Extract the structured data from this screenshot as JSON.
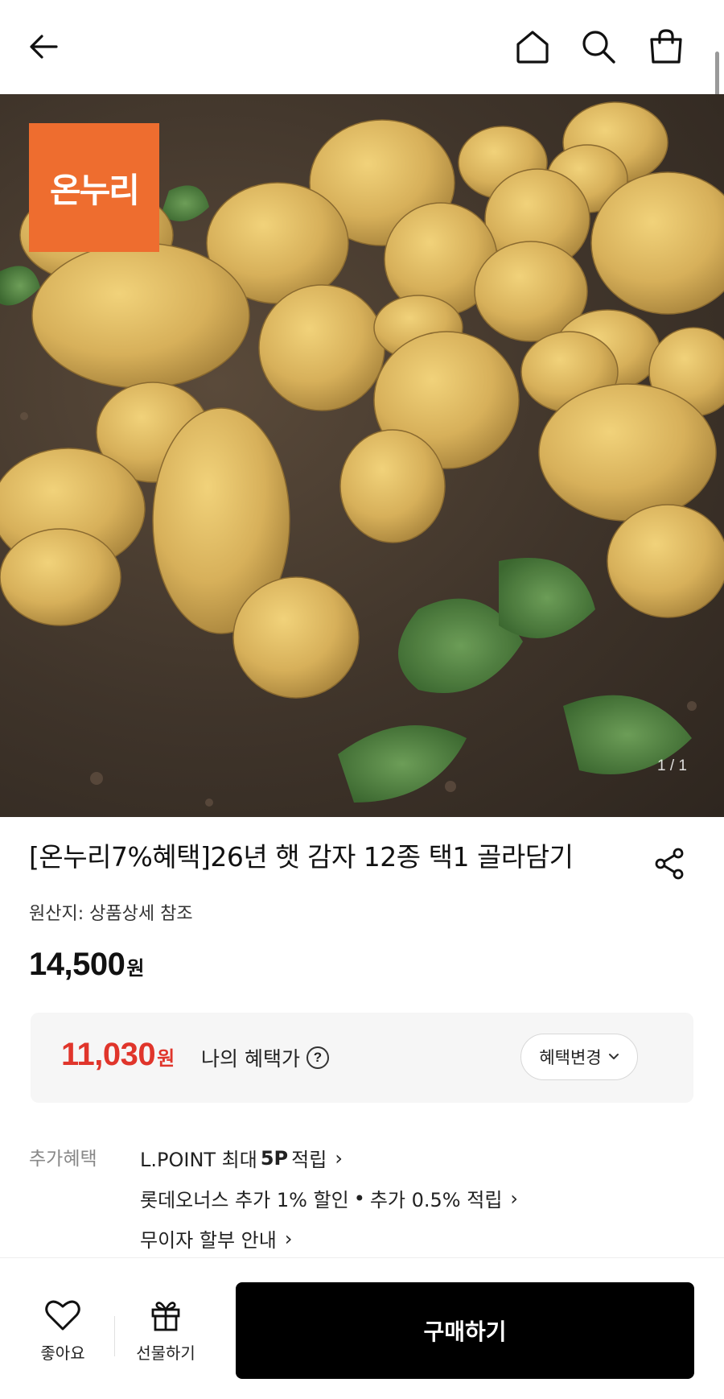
{
  "header": {
    "back_icon": "arrow-left-icon",
    "home_icon": "home-icon",
    "search_icon": "search-icon",
    "cart_icon": "shopping-bag-icon"
  },
  "product_image": {
    "brand_badge_text": "온누리",
    "brand_badge_color": "#ee6d2f",
    "counter": "1 / 1"
  },
  "product": {
    "title": "[온누리7%혜택]26년 햇 감자 12종 택1 골라담기",
    "origin": "원산지: 상품상세 참조",
    "price": "14,500",
    "price_unit": "원"
  },
  "benefit": {
    "price": "11,030",
    "price_unit": "원",
    "label": "나의 혜택가",
    "help_icon": "?",
    "change_button": "혜택변경",
    "accent_color": "#e0352b"
  },
  "extra_benefits": {
    "label": "추가혜택",
    "lpoint_prefix": "L.POINT 최대",
    "lpoint_value": "5P",
    "lpoint_suffix": "적립",
    "lottecard": "롯데오너스 추가 1% 할인",
    "lottecard_sep": "•",
    "lottecard_extra": "추가 0.5% 적립",
    "installment": "무이자 할부 안내",
    "chevron": "›"
  },
  "bottom_bar": {
    "like_label": "좋아요",
    "gift_label": "선물하기",
    "buy_label": "구매하기"
  }
}
